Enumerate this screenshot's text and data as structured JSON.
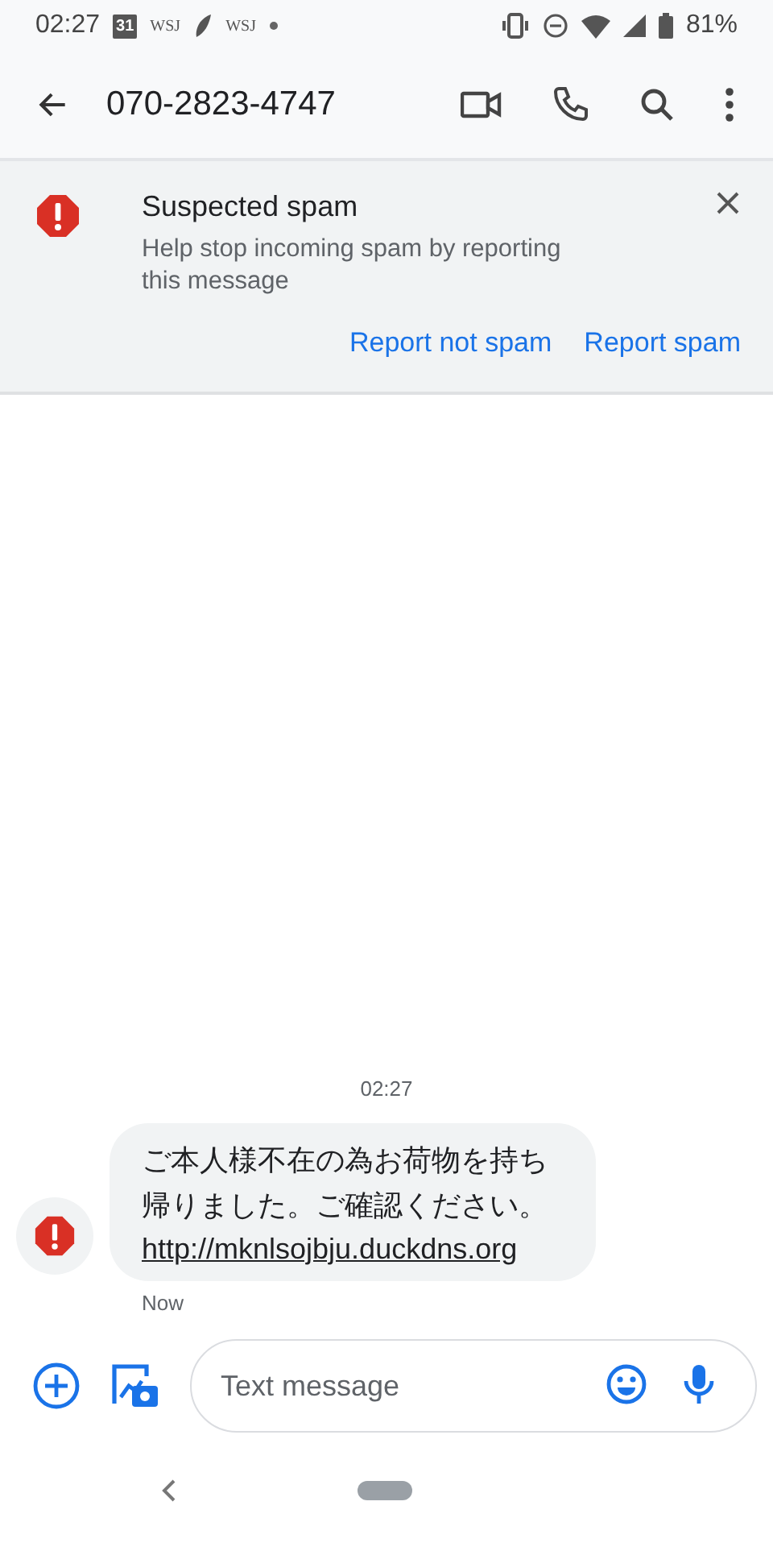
{
  "status_bar": {
    "time": "02:27",
    "calendar_day": "31",
    "notification_labels": [
      "WSJ",
      "WSJ"
    ],
    "battery": "81%"
  },
  "app_bar": {
    "title": "070-2823-4747"
  },
  "spam_banner": {
    "title": "Suspected spam",
    "body": "Help stop incoming spam by reporting this message",
    "actions": [
      "Report not spam",
      "Report spam"
    ]
  },
  "conversation": {
    "timestamp": "02:27",
    "messages": [
      {
        "text": "ご本人様不在の為お荷物を持ち帰りました。ご確認ください。",
        "link": "http://mknlsojbju.duckdns.org",
        "time": "Now",
        "spam": true
      }
    ]
  },
  "composer": {
    "placeholder": "Text message"
  }
}
